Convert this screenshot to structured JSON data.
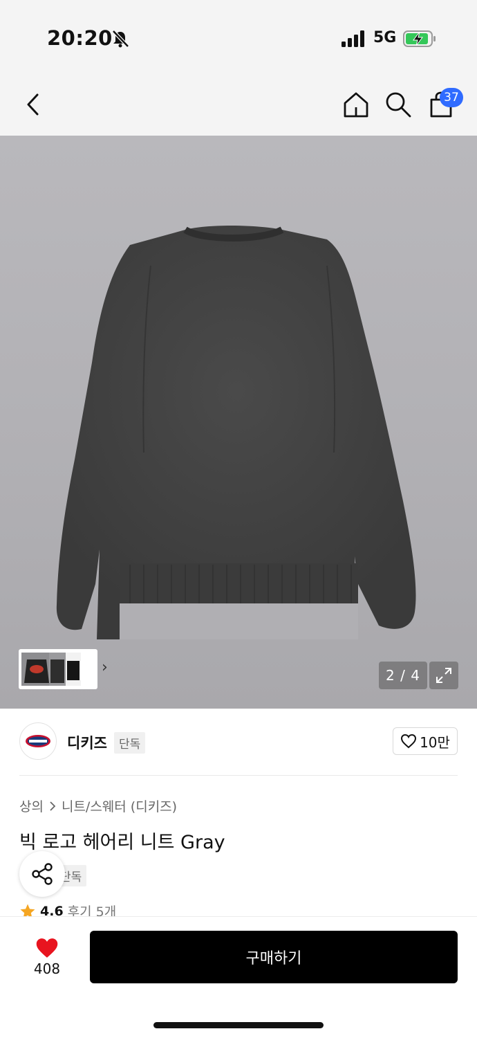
{
  "status_bar": {
    "time": "20:20",
    "network": "5G",
    "icons": [
      "bell-slash-icon",
      "signal-icon",
      "battery-charging-icon"
    ]
  },
  "nav": {
    "icons": [
      "back-icon",
      "home-icon",
      "search-icon",
      "cart-icon"
    ],
    "cart_count": "37"
  },
  "gallery": {
    "pager": "2 / 4",
    "icons": [
      "chevron-right-icon",
      "expand-icon"
    ]
  },
  "brand": {
    "name": "디키즈",
    "tag": "단독",
    "likes": "10만"
  },
  "product": {
    "breadcrumb": [
      "상의",
      "니트/스웨터 (디키즈)"
    ],
    "title": "빅 로고 헤어리 니트 Gray",
    "tag": "단독",
    "rating": "4.6",
    "reviews": "후기 5개"
  },
  "bottom": {
    "wishlist_count": "408",
    "buy_label": "구매하기"
  },
  "colors": {
    "badge": "#2f6bff",
    "heart": "#e8141f",
    "star": "#f5a623",
    "buy_button": "#000000"
  }
}
